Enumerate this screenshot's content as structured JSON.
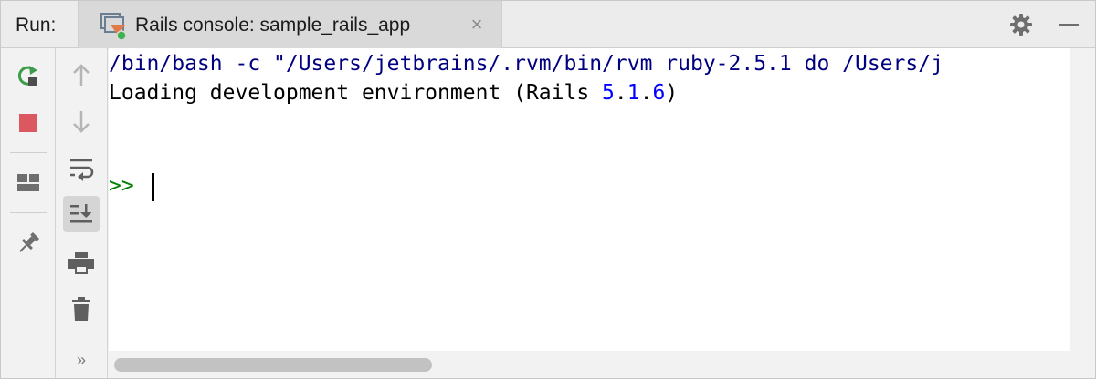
{
  "header": {
    "run_label": "Run:",
    "tab_title": "Rails console: sample_rails_app",
    "tab_close": "×"
  },
  "toolbar_left": [
    {
      "name": "rerun-icon",
      "color": "#3c9c4c"
    },
    {
      "name": "stop-icon",
      "color": "#db5860"
    },
    {
      "name": "layout-icon",
      "color": "#6e6e6e"
    },
    {
      "name": "pin-icon",
      "color": "#6e6e6e"
    }
  ],
  "toolbar_right": [
    {
      "name": "up-arrow-icon",
      "enabled": false
    },
    {
      "name": "down-arrow-icon",
      "enabled": false
    },
    {
      "name": "soft-wrap-icon",
      "enabled": true
    },
    {
      "name": "scroll-to-end-icon",
      "enabled": true,
      "active": true
    },
    {
      "name": "print-icon",
      "enabled": true
    },
    {
      "name": "trash-icon",
      "enabled": true
    }
  ],
  "more_label": "»",
  "console": {
    "command_line": "/bin/bash -c \"/Users/jetbrains/.rvm/bin/rvm ruby-2.5.1 do /Users/j",
    "loading_prefix": "Loading development environment (Rails ",
    "version_major": "5",
    "dot1": ".",
    "version_minor": "1",
    "dot2": ".",
    "version_patch": "6",
    "loading_suffix": ")",
    "prompt": ">>"
  },
  "colors": {
    "command_text": "#000080",
    "number": "#0000ff",
    "prompt": "#008000",
    "active_tab": "#d9d9d9"
  }
}
